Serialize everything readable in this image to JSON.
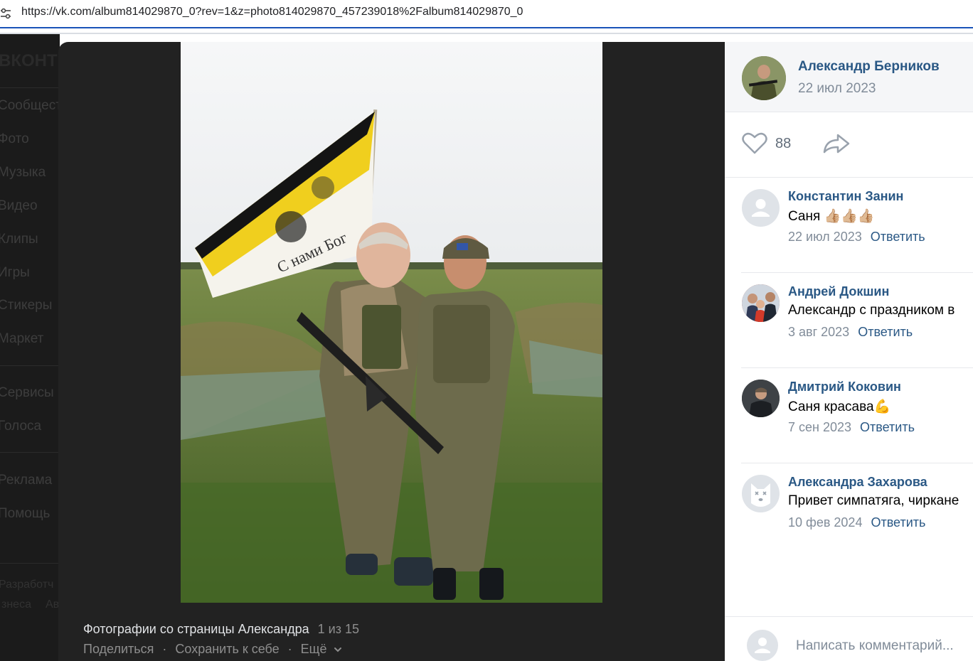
{
  "browser": {
    "url": "https://vk.com/album814029870_0?rev=1&z=photo814029870_457239018%2Falbum814029870_0",
    "tune_icon": "tune-icon"
  },
  "sidebar": {
    "logo": "ВКОНТ",
    "items": [
      {
        "label": "Сообщест"
      },
      {
        "label": "Фото"
      },
      {
        "label": "Музыка"
      },
      {
        "label": "Видео"
      },
      {
        "label": "Клипы"
      },
      {
        "label": "Игры"
      },
      {
        "label": "Стикеры"
      },
      {
        "label": "Маркет"
      },
      {
        "label": "Сервисы"
      },
      {
        "label": "Голоса"
      },
      {
        "label": "Реклама"
      },
      {
        "label": "Помощь"
      }
    ],
    "footer": {
      "developers": "Разработч",
      "business": "знеса",
      "more": "Ав"
    }
  },
  "viewer": {
    "caption": "Фотографии со страницы Александра",
    "counter": "1 из 15",
    "actions": {
      "share": "Поделиться",
      "save": "Сохранить к себе",
      "more": "Ещё"
    },
    "separator": "·"
  },
  "post": {
    "author": "Александр Берников",
    "date": "22 июл 2023",
    "likes": "88"
  },
  "comments": [
    {
      "name": "Константин Занин",
      "text": "Саня 👍🏼👍🏼👍🏼",
      "date": "22 июл 2023",
      "reply": "Ответить"
    },
    {
      "name": "Андрей Докшин",
      "text": "Александр с праздником в",
      "date": "3 авг 2023",
      "reply": "Ответить"
    },
    {
      "name": "Дмитрий Коковин",
      "text": "Саня красава💪",
      "date": "7 сен 2023",
      "reply": "Ответить"
    },
    {
      "name": "Александра Захарова",
      "text": "Привет симпатяга, чиркане",
      "date": "10 фев 2024",
      "reply": "Ответить"
    }
  ],
  "compose": {
    "placeholder": "Написать комментарий..."
  },
  "photo": {
    "flag_text": "С нами Бог",
    "colors": {
      "sky": "#e6e8ea",
      "grass": "#5f7a35",
      "flag_black": "#141414",
      "flag_yellow": "#f0cf1e",
      "accent_link": "#2a5885"
    }
  }
}
